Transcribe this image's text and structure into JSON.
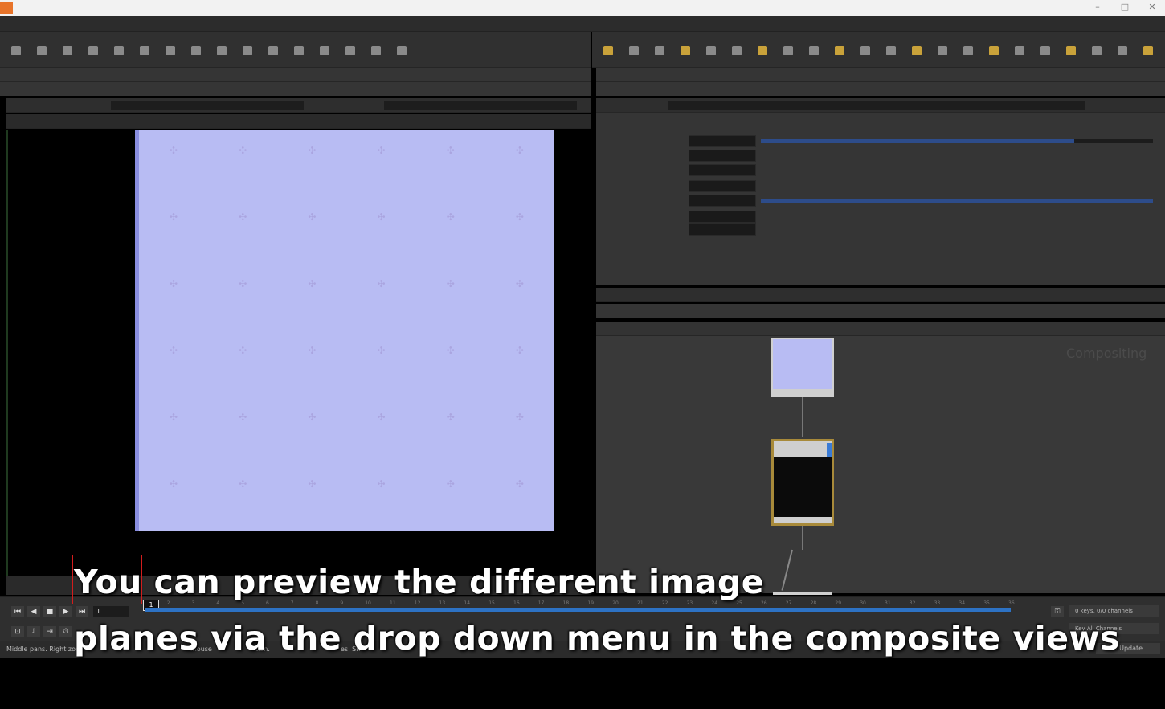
{
  "window": {
    "title": "",
    "logo_color": "#e8742a",
    "controls": [
      "–",
      "□",
      "✕"
    ]
  },
  "menu": {
    "items": []
  },
  "shelf": {
    "left_tabs": [],
    "right_tabs": [],
    "left_tools": 16,
    "right_tools": 22
  },
  "viewer": {
    "background": "#000000",
    "image_color": "#b8bcf3",
    "glyph": "✣"
  },
  "parameters": {
    "rows": [
      {
        "label": "",
        "field": "",
        "slider": 0.8
      },
      {
        "label": "",
        "field": "",
        "slider": null
      },
      {
        "label": "",
        "field": "",
        "slider": null
      },
      {
        "label": "",
        "field": "",
        "slider": null
      },
      {
        "label": "",
        "field": "",
        "slider": 1.0
      },
      {
        "label": "",
        "field": "",
        "slider": null
      },
      {
        "label": "",
        "field": "",
        "slider": null
      }
    ]
  },
  "network": {
    "context_label": "Compositing",
    "nodes": [
      {
        "name": "",
        "color": "#b8bcf3"
      },
      {
        "name": "",
        "color": "#0b0b0b",
        "outline": "#a88a3a"
      }
    ]
  },
  "timeline": {
    "current_frame": "1",
    "playhead_label": "1",
    "ruler_ticks": [
      "1",
      "2",
      "3",
      "4",
      "5",
      "6",
      "7",
      "8",
      "9",
      "10",
      "11",
      "12",
      "13",
      "14",
      "15",
      "16",
      "17",
      "18",
      "19",
      "20",
      "21",
      "22",
      "23",
      "24",
      "25",
      "26",
      "27",
      "28",
      "29",
      "30",
      "31",
      "32",
      "33",
      "34",
      "35",
      "36"
    ],
    "keys_readout": "0 keys, 0/0 channels",
    "key_all_label": "Key All Channels",
    "auto_update_label": "Auto Update"
  },
  "status": {
    "text_left": "Middle pans. Right zoo",
    "text_mid": "mouse",
    "text_mid2": "tion.",
    "text_right": "es. Sh"
  },
  "subtitles": {
    "line1": "You can preview the different image",
    "line2": "planes via the drop down menu in the composite views"
  }
}
